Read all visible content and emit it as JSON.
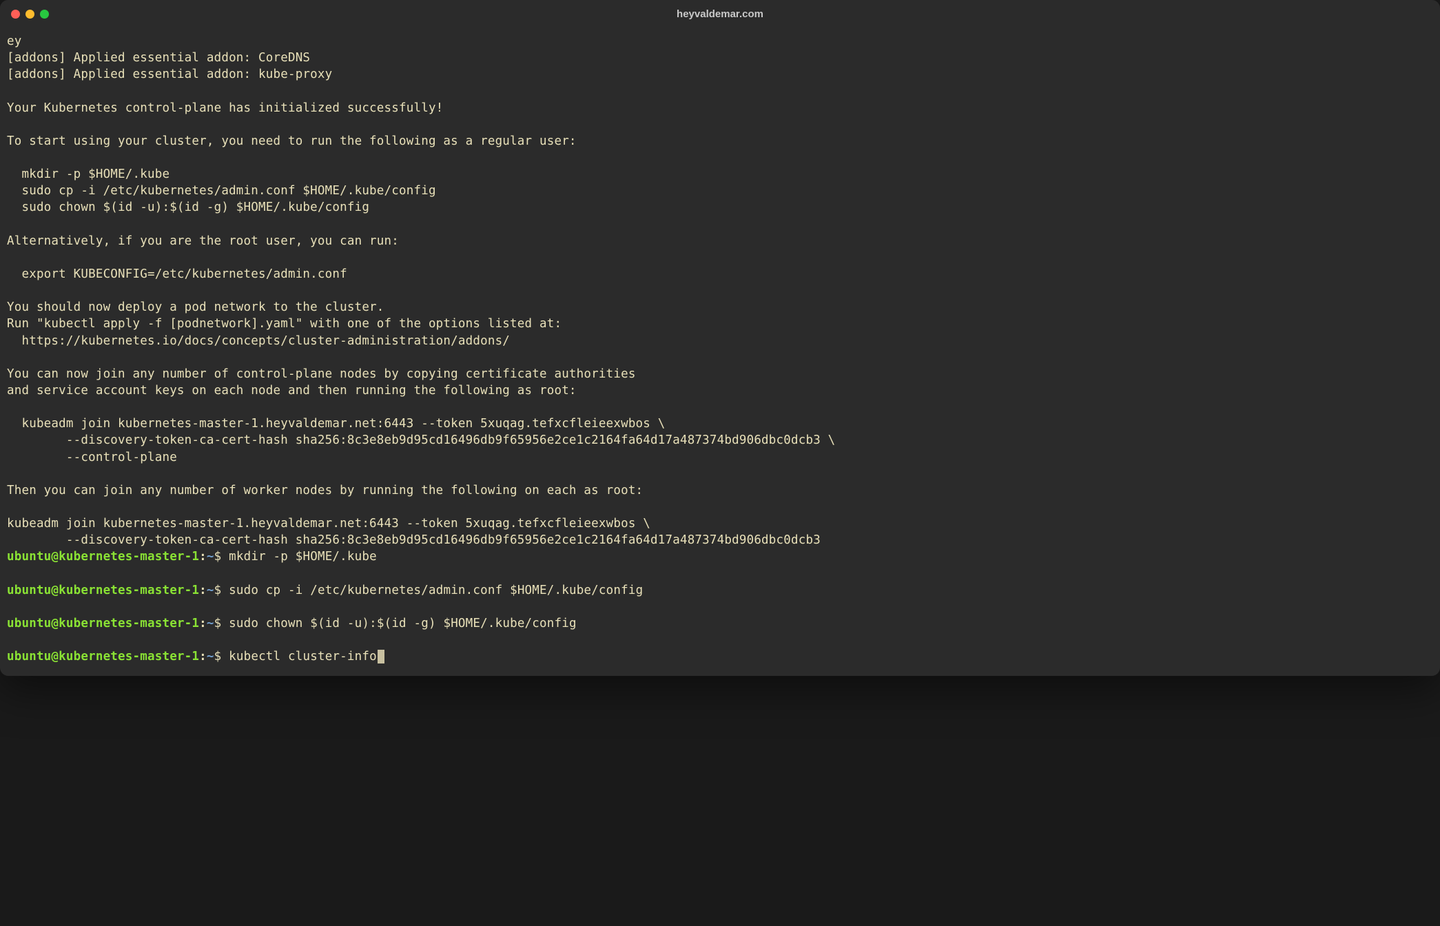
{
  "window": {
    "title": "heyvaldemar.com"
  },
  "output": {
    "l1": "ey",
    "l2": "[addons] Applied essential addon: CoreDNS",
    "l3": "[addons] Applied essential addon: kube-proxy",
    "l4": "",
    "l5": "Your Kubernetes control-plane has initialized successfully!",
    "l6": "",
    "l7": "To start using your cluster, you need to run the following as a regular user:",
    "l8": "",
    "l9": "  mkdir -p $HOME/.kube",
    "l10": "  sudo cp -i /etc/kubernetes/admin.conf $HOME/.kube/config",
    "l11": "  sudo chown $(id -u):$(id -g) $HOME/.kube/config",
    "l12": "",
    "l13": "Alternatively, if you are the root user, you can run:",
    "l14": "",
    "l15": "  export KUBECONFIG=/etc/kubernetes/admin.conf",
    "l16": "",
    "l17": "You should now deploy a pod network to the cluster.",
    "l18": "Run \"kubectl apply -f [podnetwork].yaml\" with one of the options listed at:",
    "l19": "  https://kubernetes.io/docs/concepts/cluster-administration/addons/",
    "l20": "",
    "l21": "You can now join any number of control-plane nodes by copying certificate authorities",
    "l22": "and service account keys on each node and then running the following as root:",
    "l23": "",
    "l24": "  kubeadm join kubernetes-master-1.heyvaldemar.net:6443 --token 5xuqag.tefxcfleieexwbos \\",
    "l25": "        --discovery-token-ca-cert-hash sha256:8c3e8eb9d95cd16496db9f65956e2ce1c2164fa64d17a487374bd906dbc0dcb3 \\",
    "l26": "        --control-plane",
    "l27": "",
    "l28": "Then you can join any number of worker nodes by running the following on each as root:",
    "l29": "",
    "l30": "kubeadm join kubernetes-master-1.heyvaldemar.net:6443 --token 5xuqag.tefxcfleieexwbos \\",
    "l31": "        --discovery-token-ca-cert-hash sha256:8c3e8eb9d95cd16496db9f65956e2ce1c2164fa64d17a487374bd906dbc0dcb3"
  },
  "prompt": {
    "user": "ubuntu@kubernetes-master-1",
    "colon": ":",
    "path": "~",
    "dollar": "$ "
  },
  "commands": {
    "c1": "mkdir -p $HOME/.kube",
    "c2": "sudo cp -i /etc/kubernetes/admin.conf $HOME/.kube/config",
    "c3": "sudo chown $(id -u):$(id -g) $HOME/.kube/config",
    "c4": "kubectl cluster-info"
  }
}
